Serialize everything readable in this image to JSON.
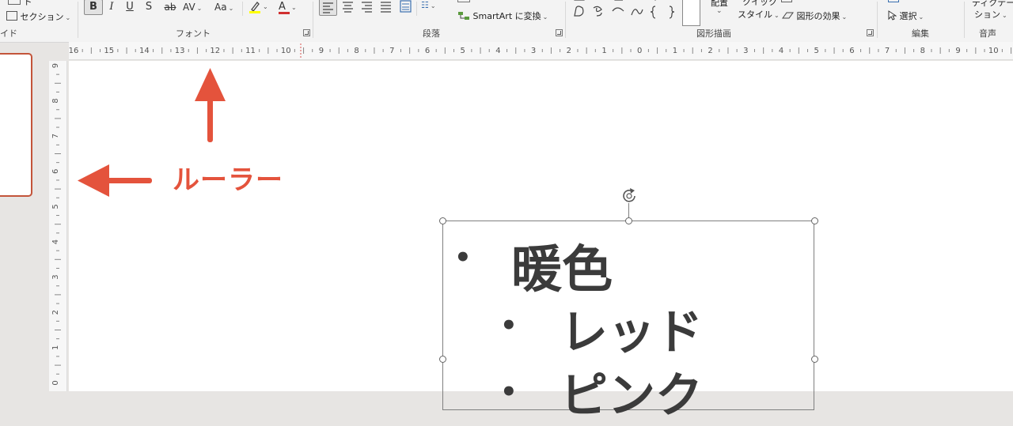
{
  "ribbon": {
    "left": {
      "top_label": "ト",
      "section_label": "セクション",
      "group_label": "イド"
    },
    "font": {
      "group_label": "フォント",
      "buttons": {
        "bold": "B",
        "italic": "I",
        "underline": "U",
        "shadow": "S",
        "strike": "ab",
        "spacing": "AV",
        "case": "Aa",
        "font_color": "A"
      }
    },
    "paragraph": {
      "group_label": "段落",
      "smartart_label": "SmartArt に変換"
    },
    "drawing": {
      "group_label": "図形描画",
      "arrange_label": "配置",
      "quick_style_top": "クイック",
      "quick_style_bottom": "スタイル",
      "shape_effects_label": "図形の効果"
    },
    "editing": {
      "group_label": "編集",
      "select_label": "選択"
    },
    "voice": {
      "group_label": "音声",
      "dictate_label": "ディクテー",
      "dictate_label2": "ション"
    }
  },
  "ruler": {
    "horizontal": [
      "16",
      "15",
      "14",
      "13",
      "12",
      "11",
      "10",
      "9",
      "8",
      "7",
      "6",
      "5",
      "4",
      "3",
      "2",
      "1",
      "0",
      "1",
      "2",
      "3",
      "4",
      "5",
      "6",
      "7",
      "8",
      "9",
      "10"
    ],
    "vertical": [
      "9",
      "8",
      "7",
      "6",
      "5",
      "4",
      "3",
      "2",
      "1",
      "0"
    ]
  },
  "annotation": {
    "label": "ルーラー",
    "color": "#e4533c"
  },
  "textbox": {
    "items": [
      {
        "level": 1,
        "bullet": "•",
        "text": "暖色"
      },
      {
        "level": 2,
        "bullet": "•",
        "text": "レッド"
      },
      {
        "level": 2,
        "bullet": "•",
        "text": "ピンク"
      }
    ]
  },
  "colors": {
    "highlight_bar": "#ffff00",
    "font_color_bar": "#d03030",
    "thumbnail_border": "#c3543a"
  }
}
